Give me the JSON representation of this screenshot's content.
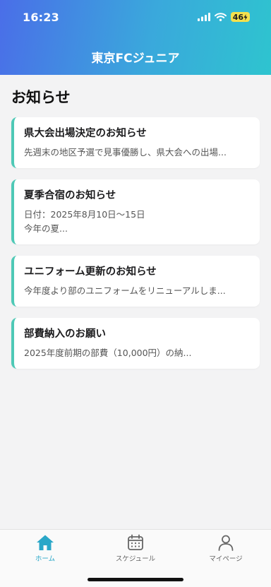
{
  "status_bar": {
    "time": "16:23",
    "battery": "46"
  },
  "header": {
    "title": "東京FCジュニア"
  },
  "page": {
    "heading": "お知らせ"
  },
  "announcements": [
    {
      "title": "県大会出場決定のお知らせ",
      "body": "先週末の地区予選で見事優勝し、県大会への出場..."
    },
    {
      "title": "夏季合宿のお知らせ",
      "body": "日付：2025年8月10日〜15日\n今年の夏..."
    },
    {
      "title": "ユニフォーム更新のお知らせ",
      "body": "今年度より部のユニフォームをリニューアルしま..."
    },
    {
      "title": "部費納入のお願い",
      "body": "2025年度前期の部費（10,000円）の納..."
    }
  ],
  "tabs": [
    {
      "label": "ホーム",
      "icon": "home-icon",
      "active": true
    },
    {
      "label": "スケジュール",
      "icon": "calendar-icon",
      "active": false
    },
    {
      "label": "マイページ",
      "icon": "person-icon",
      "active": false
    }
  ],
  "colors": {
    "header_gradient_start": "#4a6ee8",
    "header_gradient_end": "#2ec4cf",
    "card_accent": "#4ec9b6",
    "active_tab": "#2aa7c8",
    "battery": "#f4e04d"
  }
}
